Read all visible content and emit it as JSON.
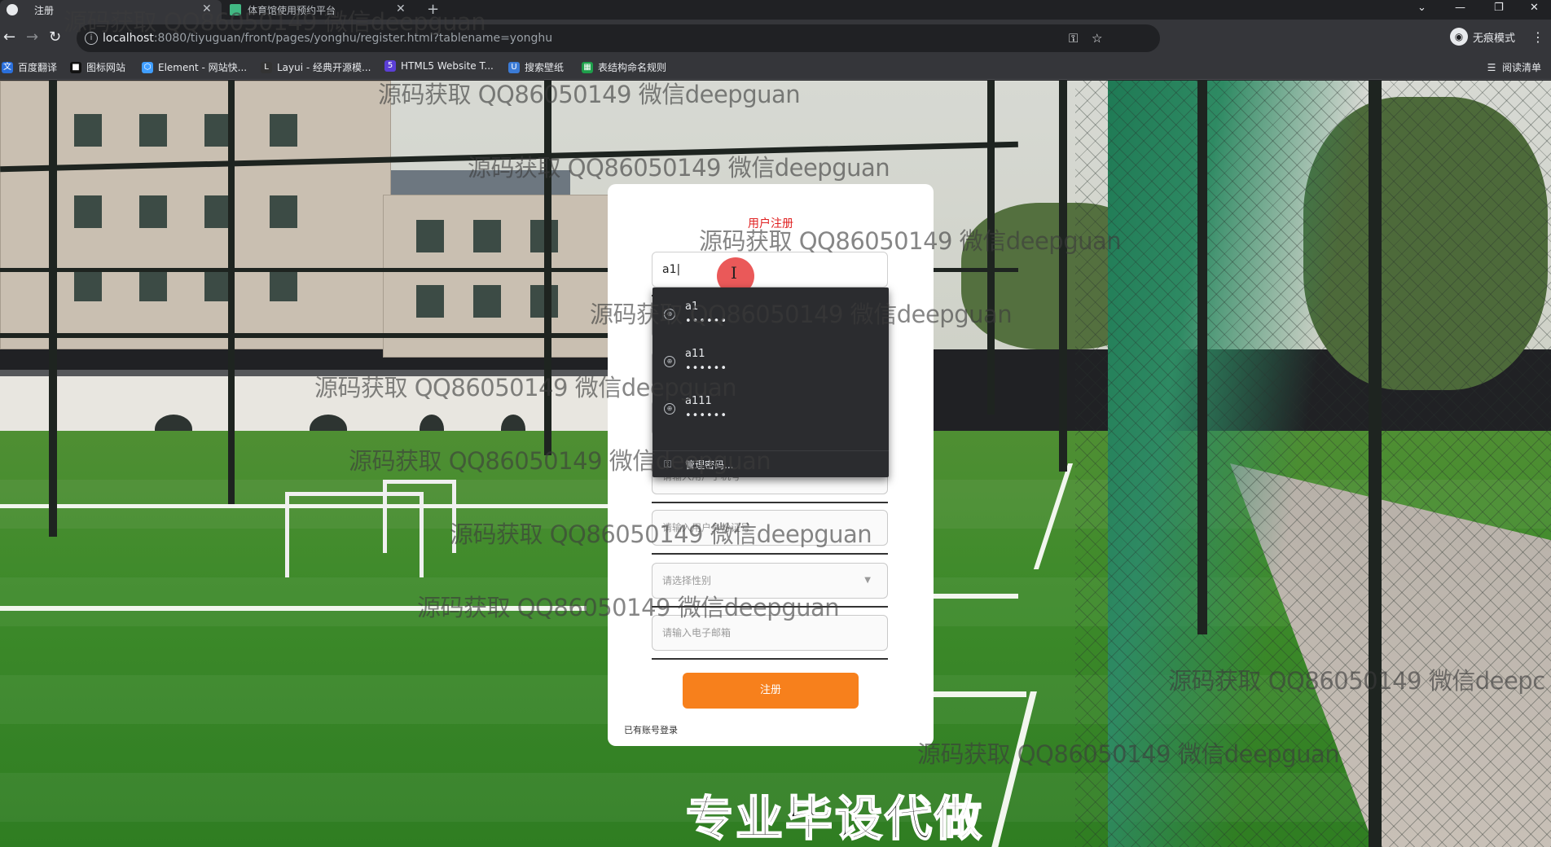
{
  "browser": {
    "tabs": [
      {
        "title": "注册",
        "active": true
      },
      {
        "title": "体育馆使用预约平台",
        "active": false
      }
    ],
    "new_tab": "+",
    "window_controls": {
      "tabs_dropdown": "⌄",
      "minimize": "—",
      "restore": "❐",
      "close": "✕"
    },
    "url_host": "localhost",
    "url_rest": ":8080/tiyuguan/front/pages/yonghu/register.html?tablename=yonghu",
    "incognito_label": "无痕模式",
    "bookmarks": [
      {
        "label": "百度翻译",
        "color": "#2a6fdb"
      },
      {
        "label": "图标网站",
        "color": "#111111"
      },
      {
        "label": "Element - 网站快...",
        "color": "#409eff"
      },
      {
        "label": "Layui - 经典开源模...",
        "color": "#333333"
      },
      {
        "label": "HTML5 Website T...",
        "color": "#5b3fd6"
      },
      {
        "label": "搜索壁纸",
        "color": "#3b7bd6"
      },
      {
        "label": "表结构命名规则",
        "color": "#1e9e4a"
      }
    ],
    "reading_list": "阅读清单"
  },
  "register": {
    "title": "用户注册",
    "username_value": "a1",
    "phone_placeholder": "请输入用户手机号",
    "idcard_placeholder": "请输入用户身份证号",
    "gender_placeholder": "请选择性别",
    "email_placeholder": "请输入电子邮箱",
    "submit_label": "注册",
    "login_link": "已有账号登录"
  },
  "autofill": {
    "items": [
      {
        "user": "a1",
        "password": "••••••"
      },
      {
        "user": "a11",
        "password": "••••••"
      },
      {
        "user": "a111",
        "password": "••••••"
      }
    ],
    "manage_label": "管理密码..."
  },
  "overlay": {
    "watermark": "源码获取 QQ86050149 微信deepguan",
    "watermark_cut": "源码获取 QQ86050149 微信deepc",
    "caption": "专业毕设代做"
  }
}
